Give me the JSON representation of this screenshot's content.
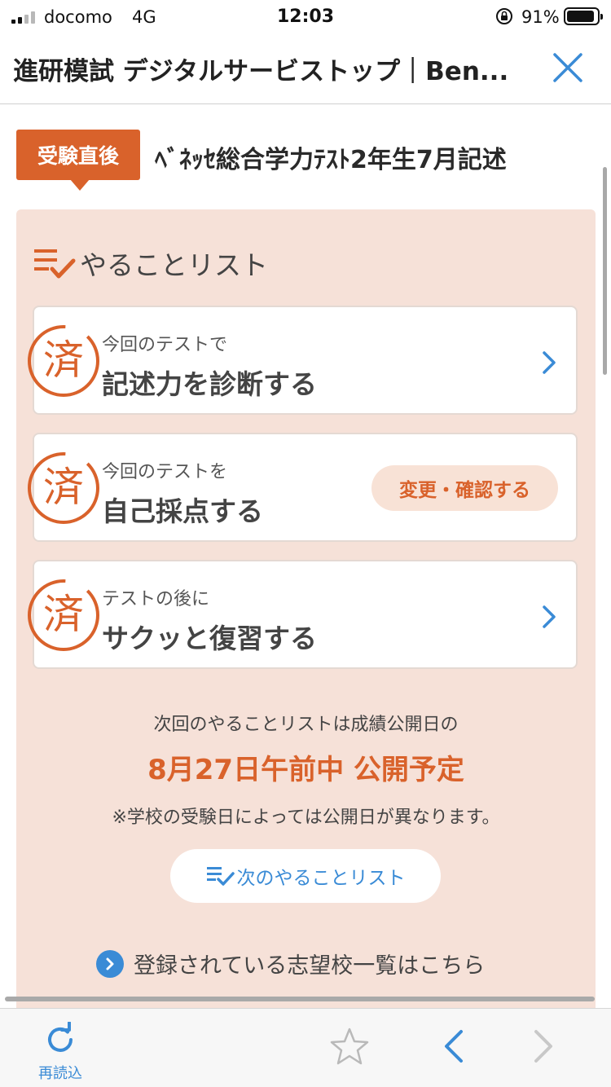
{
  "status_bar": {
    "carrier": "docomo",
    "network": "4G",
    "time": "12:03",
    "battery_percent": "91%",
    "battery_level": 0.91
  },
  "nav": {
    "title": "進研模試 デジタルサービストップ｜Ben...",
    "close_icon": "close-icon"
  },
  "headline": {
    "badge": "受験直後",
    "title": "ﾍﾞﾈｯｾ総合学力ﾃｽﾄ2年生7月記述"
  },
  "todo": {
    "title": "やることリスト",
    "items": [
      {
        "sub": "今回のテストで",
        "main": "記述力を診断する",
        "stamp": "済",
        "action": "chevron-right-icon"
      },
      {
        "sub": "今回のテストを",
        "main": "自己採点する",
        "stamp": "済",
        "button": "変更・確認する"
      },
      {
        "sub": "テストの後に",
        "main": "サクッと復習する",
        "stamp": "済",
        "action": "chevron-right-icon"
      }
    ]
  },
  "next": {
    "lead": "次回のやることリストは成績公開日の",
    "date": "8月27日午前中 公開予定",
    "note": "※学校の受験日によっては公開日が異なります。",
    "button": "次のやることリスト",
    "school_link": "登録されている志望校一覧はこちら"
  },
  "toolbar": {
    "reload_label": "再読込",
    "icons": [
      "reload-icon",
      "star-icon",
      "back-icon",
      "forward-icon"
    ]
  },
  "colors": {
    "accent": "#d9622b",
    "panel_bg": "#f6e1d8",
    "link_blue": "#3a8bd6"
  }
}
